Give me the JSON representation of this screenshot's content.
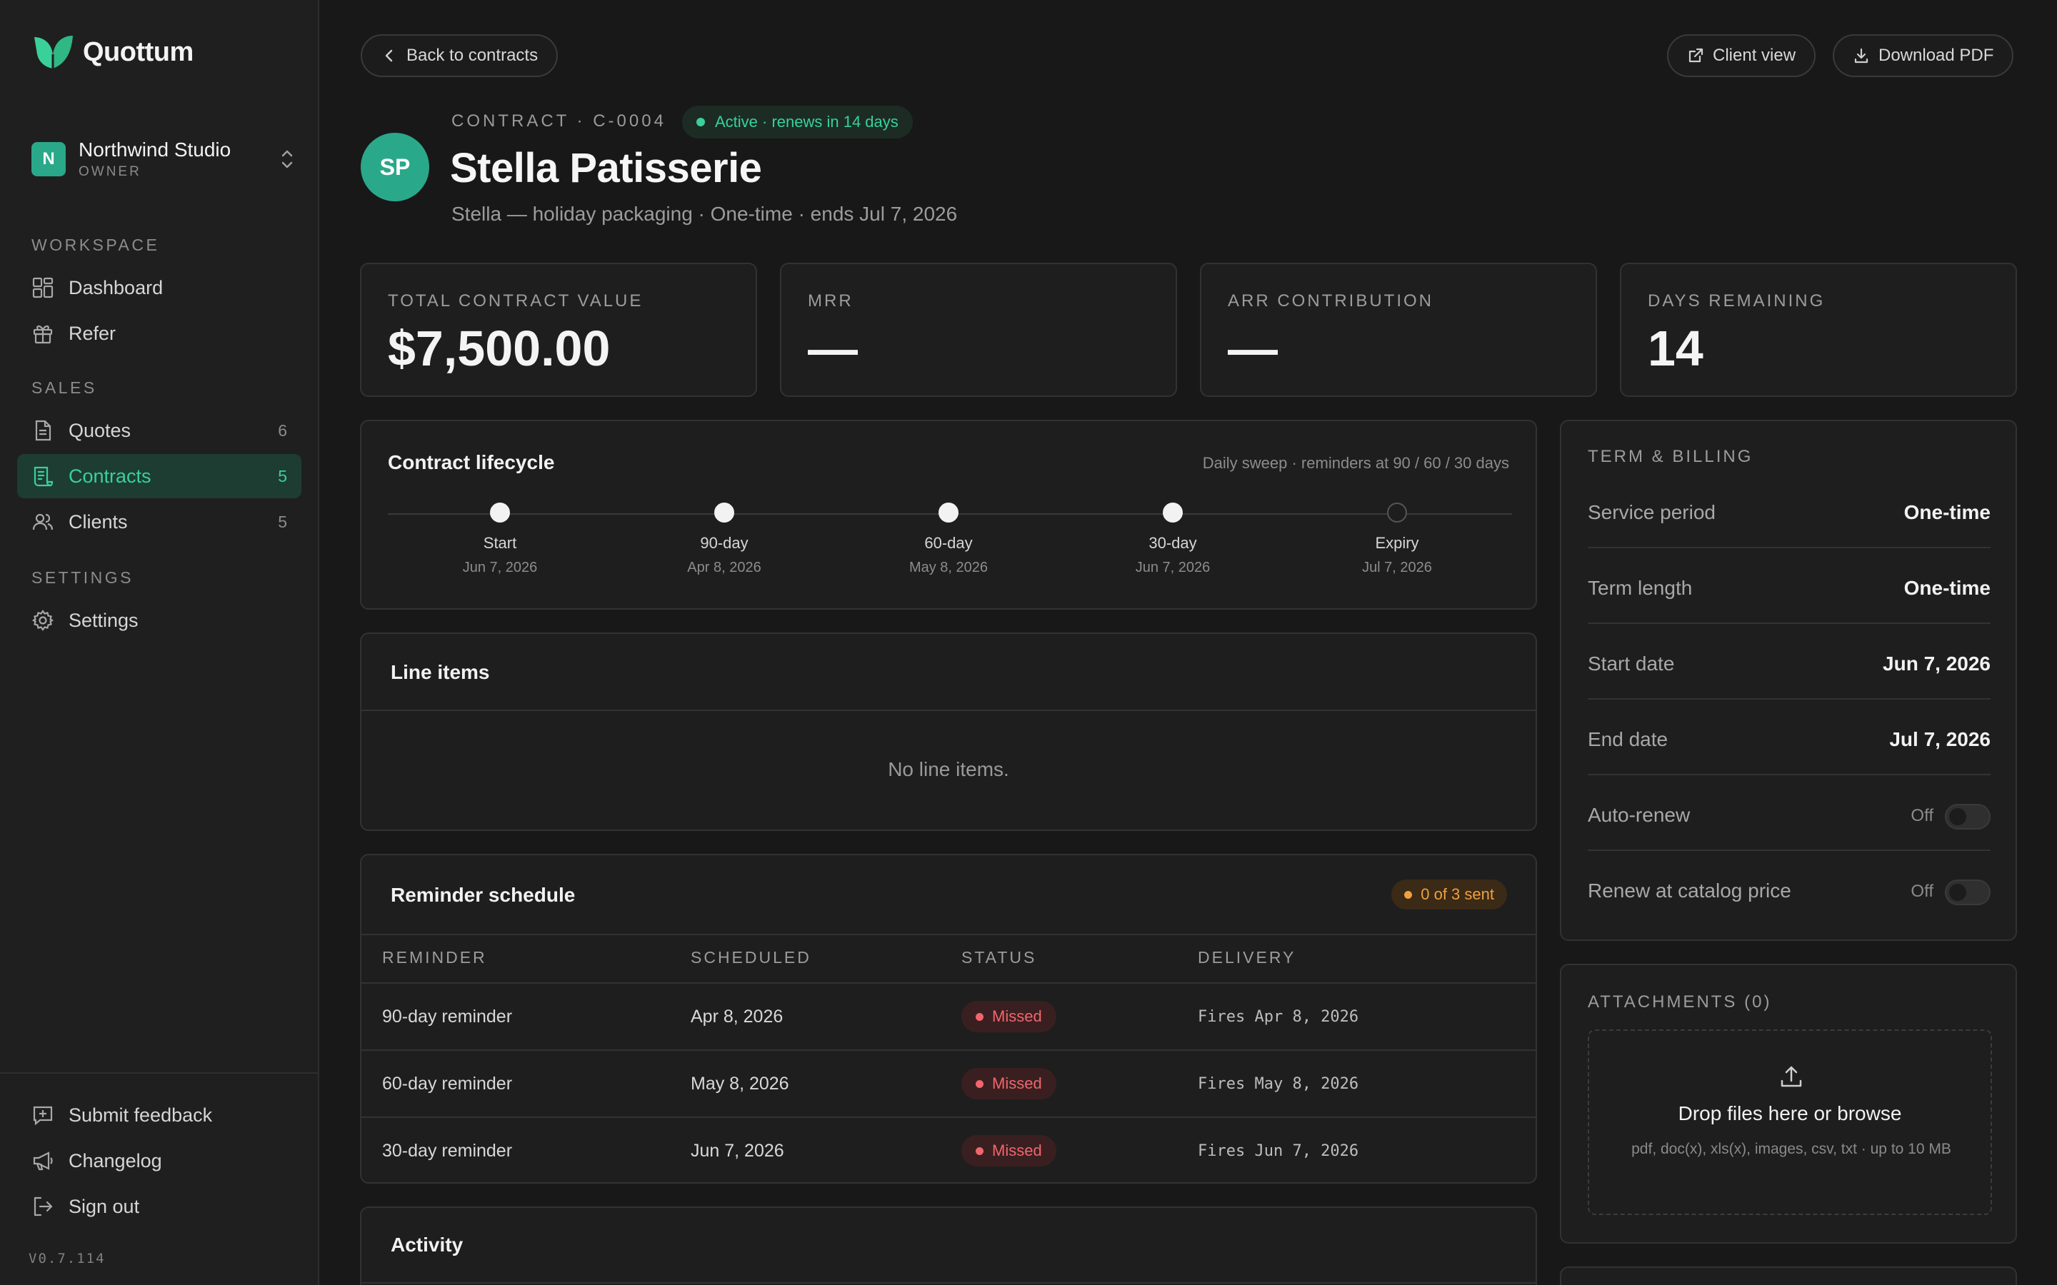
{
  "brand": {
    "name": "Quottum"
  },
  "org": {
    "avatar": "N",
    "name": "Northwind Studio",
    "role": "OWNER"
  },
  "nav": {
    "workspace_label": "WORKSPACE",
    "dashboard": "Dashboard",
    "refer": "Refer",
    "sales_label": "SALES",
    "quotes": {
      "label": "Quotes",
      "count": "6"
    },
    "contracts": {
      "label": "Contracts",
      "count": "5"
    },
    "clients": {
      "label": "Clients",
      "count": "5"
    },
    "settings_label": "SETTINGS",
    "settings": "Settings"
  },
  "footer": {
    "feedback": "Submit feedback",
    "changelog": "Changelog",
    "signout": "Sign out",
    "version": "V0.7.114"
  },
  "toolbar": {
    "back": "Back to contracts",
    "client_view": "Client view",
    "download": "Download PDF"
  },
  "contract": {
    "avatar": "SP",
    "eyebrow": "CONTRACT · C-0004",
    "status": "Active · renews in 14 days",
    "title": "Stella Patisserie",
    "subtitle": "Stella — holiday packaging · One-time · ends Jul 7, 2026"
  },
  "kpis": [
    {
      "label": "TOTAL CONTRACT VALUE",
      "value": "$7,500.00"
    },
    {
      "label": "MRR",
      "value": "—"
    },
    {
      "label": "ARR CONTRIBUTION",
      "value": "—"
    },
    {
      "label": "DAYS REMAINING",
      "value": "14"
    }
  ],
  "lifecycle": {
    "title": "Contract lifecycle",
    "note": "Daily sweep · reminders at 90 / 60 / 30 days",
    "steps": [
      {
        "label": "Start",
        "date": "Jun 7, 2026"
      },
      {
        "label": "90-day",
        "date": "Apr 8, 2026"
      },
      {
        "label": "60-day",
        "date": "May 8, 2026"
      },
      {
        "label": "30-day",
        "date": "Jun 7, 2026"
      },
      {
        "label": "Expiry",
        "date": "Jul 7, 2026"
      }
    ]
  },
  "line_items": {
    "title": "Line items",
    "empty": "No line items."
  },
  "reminders": {
    "title": "Reminder schedule",
    "sent": "0 of 3 sent",
    "headers": [
      "REMINDER",
      "SCHEDULED",
      "STATUS",
      "DELIVERY"
    ],
    "rows": [
      {
        "name": "90-day reminder",
        "scheduled": "Apr 8, 2026",
        "status": "Missed",
        "delivery": "Fires Apr 8, 2026"
      },
      {
        "name": "60-day reminder",
        "scheduled": "May 8, 2026",
        "status": "Missed",
        "delivery": "Fires May 8, 2026"
      },
      {
        "name": "30-day reminder",
        "scheduled": "Jun 7, 2026",
        "status": "Missed",
        "delivery": "Fires Jun 7, 2026"
      }
    ]
  },
  "activity": {
    "title": "Activity"
  },
  "billing": {
    "title": "TERM & BILLING",
    "service_period": {
      "label": "Service period",
      "value": "One-time"
    },
    "term_length": {
      "label": "Term length",
      "value": "One-time"
    },
    "start_date": {
      "label": "Start date",
      "value": "Jun 7, 2026"
    },
    "end_date": {
      "label": "End date",
      "value": "Jul 7, 2026"
    },
    "auto_renew": {
      "label": "Auto-renew",
      "state": "Off"
    },
    "renew_catalog": {
      "label": "Renew at catalog price",
      "state": "Off"
    }
  },
  "attachments": {
    "title": "ATTACHMENTS (0)",
    "drop_title": "Drop files here or browse",
    "drop_note": "pdf, doc(x), xls(x), images, csv, txt · up to 10 MB"
  },
  "colors": {
    "accent": "#3ad09a",
    "danger": "#f0666c",
    "warning": "#f0a040"
  }
}
